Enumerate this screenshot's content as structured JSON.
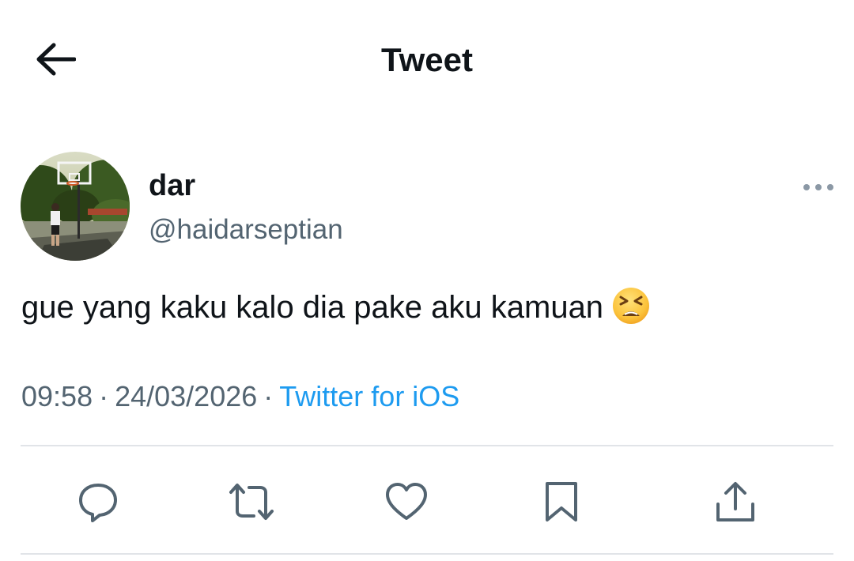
{
  "header": {
    "title": "Tweet",
    "back_icon": "arrow-left-icon"
  },
  "tweet": {
    "author": {
      "display_name": "dar",
      "handle": "@haidarseptian",
      "avatar": "basketball-court-photo"
    },
    "more_icon": "more-horizontal-icon",
    "text": "gue yang kaku kalo dia pake aku kamuan",
    "emoji": "tired-face-emoji",
    "time": "09:58",
    "separator": "·",
    "date": "24/03/2026",
    "source": "Twitter for iOS"
  },
  "actions": {
    "reply_icon": "reply-icon",
    "retweet_icon": "retweet-icon",
    "like_icon": "heart-icon",
    "bookmark_icon": "bookmark-icon",
    "share_icon": "share-icon"
  },
  "colors": {
    "text_primary": "#0f1419",
    "text_secondary": "#536471",
    "link": "#1d9bf0",
    "divider": "#e1e4e8"
  }
}
